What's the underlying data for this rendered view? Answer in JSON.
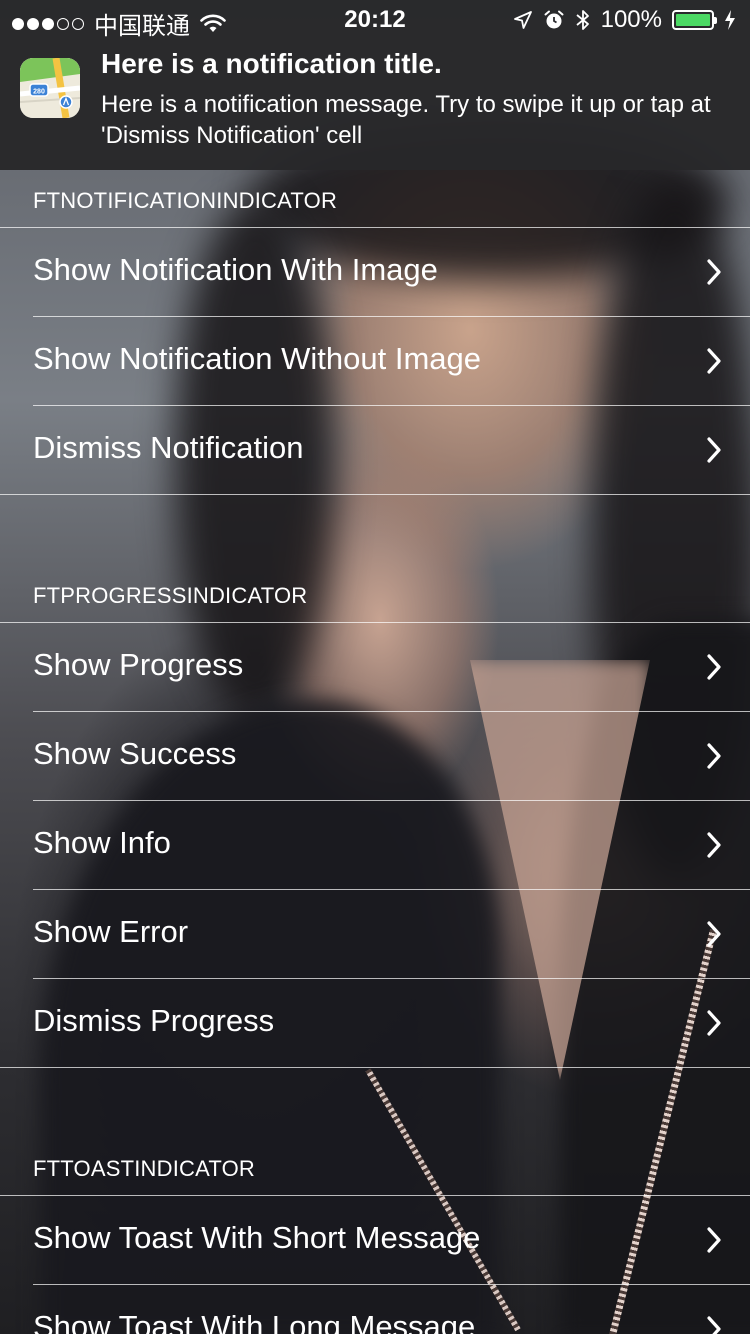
{
  "status_bar": {
    "carrier": "中国联通",
    "time": "20:12",
    "battery_percent": "100%",
    "battery_level": 1.0,
    "battery_color": "#4cd964",
    "icons": [
      "signal-dots-icon",
      "wifi-icon",
      "location-arrow-icon",
      "alarm-clock-icon",
      "bluetooth-icon",
      "battery-icon",
      "charging-bolt-icon"
    ]
  },
  "notification": {
    "app_icon": "maps-app-icon",
    "title": "Here is a notification title.",
    "message": "Here is a notification message. Try to swipe it up or tap at 'Dismiss Notification' cell"
  },
  "sections": [
    {
      "header": "FTNOTIFICATIONINDICATOR",
      "rows": [
        "Show Notification With Image",
        "Show Notification Without Image",
        "Dismiss Notification"
      ]
    },
    {
      "header": "FTPROGRESSINDICATOR",
      "rows": [
        "Show Progress",
        "Show Success",
        "Show Info",
        "Show Error",
        "Dismiss Progress"
      ]
    },
    {
      "header": "FTTOASTINDICATOR",
      "rows": [
        "Show Toast With Short Message",
        "Show Toast With Long Message"
      ]
    }
  ],
  "row_icon": "chevron-right-icon"
}
